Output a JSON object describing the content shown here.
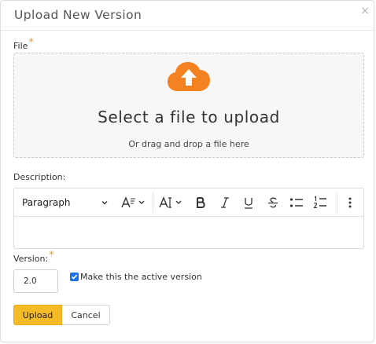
{
  "dialog": {
    "title": "Upload New Version",
    "close_glyph": "×"
  },
  "file": {
    "label": "File",
    "required_mark": "*",
    "icon": "cloud-upload-icon",
    "icon_color": "#f58220",
    "drop_title": "Select a file to upload",
    "drop_subtitle": "Or drag and drop a file here"
  },
  "description": {
    "label": "Description:",
    "toolbar": {
      "paragraph_label": "Paragraph",
      "buttons": [
        "chevron-down-icon",
        "font-style-icon",
        "font-size-icon",
        "bold-icon",
        "italic-icon",
        "underline-icon",
        "strikethrough-icon",
        "bulleted-list-icon",
        "numbered-list-icon",
        "more-options-icon"
      ]
    },
    "value": ""
  },
  "version": {
    "label": "Version:",
    "required_mark": "*",
    "value": "2.0",
    "active_checkbox_checked": true,
    "active_checkbox_label": "Make this the active version"
  },
  "actions": {
    "upload_label": "Upload",
    "cancel_label": "Cancel",
    "upload_color": "#f5bb26"
  }
}
